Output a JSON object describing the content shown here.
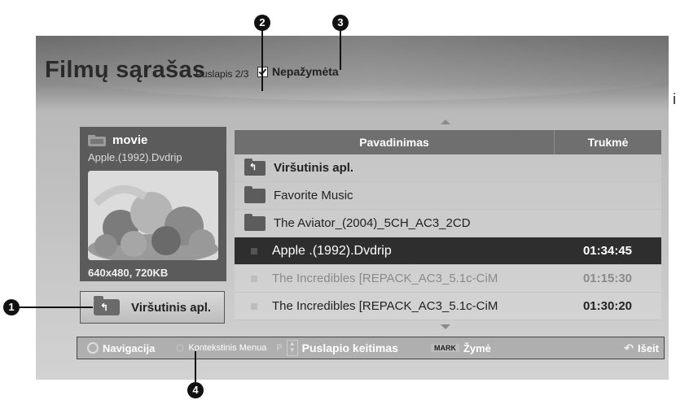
{
  "title": "Filmų sąrašas",
  "page_indicator": "Puslapis 2/3",
  "checkbox_label": "Nepažymėta",
  "preview": {
    "folder_label": "movie",
    "file_name": "Apple.(1992).Dvdrip",
    "resolution": "640x480, 720KB"
  },
  "up_button_label": "Viršutinis apl.",
  "table": {
    "col_name": "Pavadinimas",
    "col_duration": "Trukmė",
    "rows": [
      {
        "name": "Viršutinis apl.",
        "duration": "",
        "icon": "folder-up-icon",
        "bold": true
      },
      {
        "name": "Favorite Music",
        "duration": "",
        "icon": "folder-icon"
      },
      {
        "name": "The Aviator_(2004)_5CH_AC3_2CD",
        "duration": "",
        "icon": "folder-icon"
      },
      {
        "name": "Apple .(1992).Dvdrip",
        "duration": "01:34:45",
        "icon": "file-icon",
        "selected": true
      },
      {
        "name": "The Incredibles [REPACK_AC3_5.1c-CiM",
        "duration": "01:15:30",
        "icon": "file-icon",
        "dim": true
      },
      {
        "name": "The Incredibles [REPACK_AC3_5.1c-CiM",
        "duration": "01:30:20",
        "icon": "file-icon"
      }
    ]
  },
  "bottom_bar": {
    "navigation": "Navigacija",
    "context_menu": "Kontekstinis Menua",
    "page_change_prefix": "P",
    "page_change": "Puslapio keitimas",
    "mark_key": "MARK",
    "mark": "Žymė",
    "exit": "Išeit"
  },
  "callouts": [
    "1",
    "2",
    "3",
    "4"
  ],
  "edge_text": "i"
}
